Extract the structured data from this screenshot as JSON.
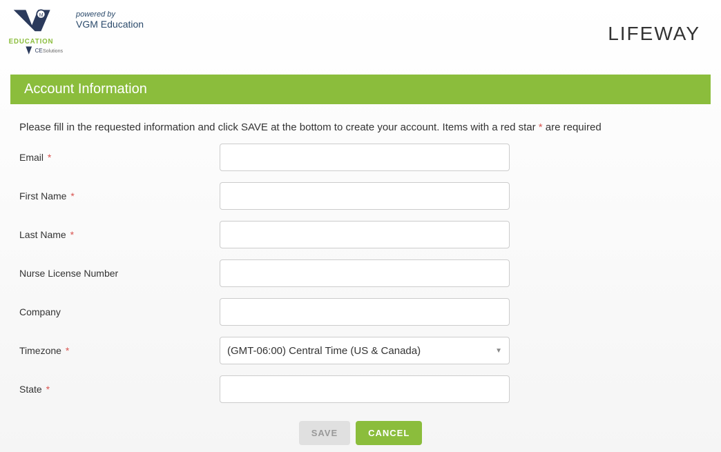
{
  "header": {
    "powered_label": "powered by",
    "powered_name": "VGM Education",
    "brand": "LIFEWAY"
  },
  "section": {
    "title": "Account Information"
  },
  "instructions": {
    "text_before": "Please fill in the requested information and click SAVE at the bottom to create your account. Items with a red star ",
    "star": "*",
    "text_after": " are required"
  },
  "form": {
    "fields": [
      {
        "label": "Email",
        "required": true,
        "value": "",
        "type": "text"
      },
      {
        "label": "First Name",
        "required": true,
        "value": "",
        "type": "text"
      },
      {
        "label": "Last Name",
        "required": true,
        "value": "",
        "type": "text"
      },
      {
        "label": "Nurse License Number",
        "required": false,
        "value": "",
        "type": "text"
      },
      {
        "label": "Company",
        "required": false,
        "value": "",
        "type": "text"
      },
      {
        "label": "Timezone",
        "required": true,
        "value": "(GMT-06:00) Central Time (US & Canada)",
        "type": "select"
      },
      {
        "label": "State",
        "required": true,
        "value": "",
        "type": "text"
      }
    ]
  },
  "buttons": {
    "save": "SAVE",
    "cancel": "CANCEL"
  },
  "logo": {
    "education_text": "EDUCATION",
    "ce_text": "CESolutions"
  }
}
